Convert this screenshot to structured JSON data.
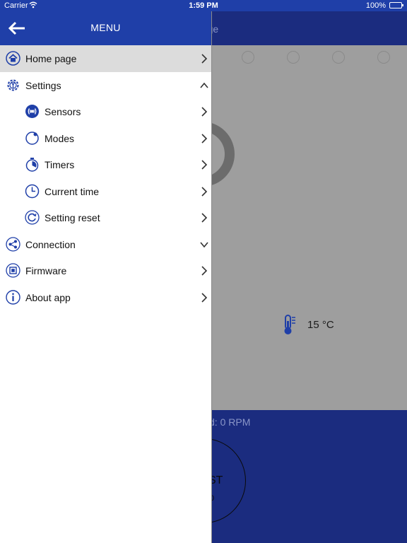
{
  "status_bar": {
    "carrier": "Carrier",
    "time": "1:59 PM",
    "battery": "100%"
  },
  "drawer": {
    "title": "MENU",
    "items": [
      {
        "label": "Home page",
        "chevron": "right",
        "selected": true
      },
      {
        "label": "Settings",
        "chevron": "up"
      },
      {
        "label": "Sensors",
        "chevron": "right",
        "sub": true
      },
      {
        "label": "Modes",
        "chevron": "right",
        "sub": true
      },
      {
        "label": "Timers",
        "chevron": "right",
        "sub": true
      },
      {
        "label": "Current time",
        "chevron": "right",
        "sub": true
      },
      {
        "label": "Setting reset",
        "chevron": "right",
        "sub": true
      },
      {
        "label": "Connection",
        "chevron": "down"
      },
      {
        "label": "Firmware",
        "chevron": "right"
      },
      {
        "label": "About app",
        "chevron": "right"
      }
    ]
  },
  "background": {
    "header_title_partial": "page",
    "temperature": "15 °C",
    "speed_partial": "d: 0 RPM",
    "button_partial": "ST",
    "button_sub_partial": "0"
  },
  "colors": {
    "accent": "#1f3fa8",
    "background_header": "#1b2c7f",
    "selected_row": "#dcdcdc"
  }
}
